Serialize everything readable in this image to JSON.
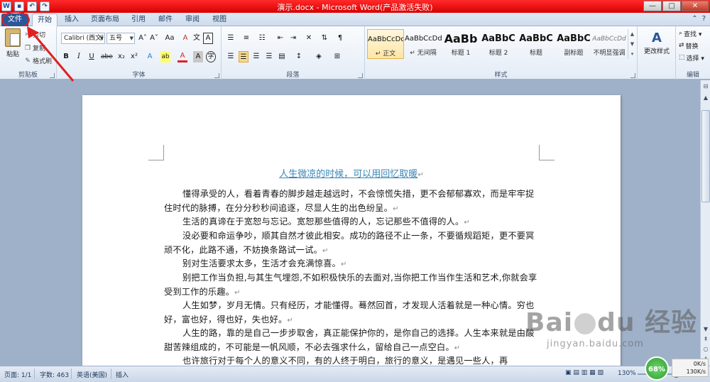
{
  "window": {
    "title": "演示.docx - Microsoft Word(产品激活失败)",
    "controls": [
      "—",
      "□",
      "✕"
    ]
  },
  "tabs": [
    "文件",
    "开始",
    "插入",
    "页面布局",
    "引用",
    "邮件",
    "审阅",
    "视图"
  ],
  "active_tab": "开始",
  "ribbon": {
    "clipboard": {
      "label": "剪贴板",
      "paste": "粘贴",
      "cut": "剪切",
      "copy": "复制",
      "format_painter": "格式刷"
    },
    "font": {
      "label": "字体",
      "font_name": "Calibri (西文ī",
      "font_size": "五号",
      "grow": "A˄",
      "shrink": "A˅",
      "case": "Aa",
      "clear": "A",
      "phonetic": "文",
      "border_char": "A",
      "bold": "B",
      "italic": "I",
      "underline": "U",
      "strike": "abe",
      "subscript": "x₂",
      "superscript": "x²",
      "text_effect": "A",
      "highlight": "ab",
      "font_color": "A",
      "shading": "A",
      "enclose": "字"
    },
    "paragraph": {
      "label": "段落"
    },
    "styles": {
      "label": "样式",
      "items": [
        {
          "preview": "AaBbCcDd",
          "name": "↵ 正文"
        },
        {
          "preview": "AaBbCcDd",
          "name": "↵ 无间隔"
        },
        {
          "preview": "AaBb",
          "name": "标题 1"
        },
        {
          "preview": "AaBbC",
          "name": "标题 2"
        },
        {
          "preview": "AaBbC",
          "name": "标题"
        },
        {
          "preview": "AaBbC",
          "name": "副标题"
        },
        {
          "preview": "AaBbCcDd",
          "name": "不明显强调"
        }
      ],
      "change_styles": "更改样式"
    },
    "editing": {
      "label": "编辑",
      "find": "查找 ▾",
      "replace": "替换",
      "select": "选择 ▾"
    }
  },
  "document": {
    "title": "人生微凉的时候，可以用回忆取暖",
    "paragraphs": [
      "懂得承受的人，看着青春的脚步越走越远时，不会惊慌失措，更不会郁郁寡欢，而是牢牢捉住时代的脉搏，在分分秒秒间追逐，尽显人生的出色纷呈。",
      "生活的真谛在于宽恕与忘记。宽恕那些值得的人，忘记那些不值得的人。",
      "没必要和命运争吵，顺其自然才彼此相安。成功的路径不止一条，不要循规蹈矩，更不要冥顽不化，此路不通，不妨换条路试一试。",
      "别对生活要求太多，生活才会充满惊喜。",
      "别把工作当负担,与其生气埋怨,不如积极快乐的去面对,当你把工作当作生活和艺术,你就会享受到工作的乐趣。",
      "人生如梦，岁月无情。只有经历，才能懂得。蓦然回首，才发现人活着就是一种心情。穷也好，富也好，得也好，失也好。",
      "人生的路，靠的是自己一步步取舍，真正能保护你的，是你自己的选择。人生本来就是由酸甜苦辣组成的，不可能是一帆风顺，不必去强求什么，留给自己一点空白。",
      "也许旅行对于每个人的意义不同，有的人终于明白，旅行的意义，是遇见一些人，再"
    ]
  },
  "status": {
    "page": "页面: 1/1",
    "words": "字数: 463",
    "language": "英语(美国)",
    "mode": "插入",
    "zoom": "130%"
  },
  "watermark": {
    "logo_a": "Bai",
    "logo_b": "du",
    "logo_c": "经验",
    "sub": "jingyan.baidu.com"
  },
  "speed": {
    "percent": "68%",
    "up": "0K/s",
    "down": "130K/s"
  },
  "colors": {
    "titlebar": "#e00000",
    "file_tab": "#2b579a",
    "doc_title": "#3a86b5",
    "annotation": "#e02020"
  }
}
